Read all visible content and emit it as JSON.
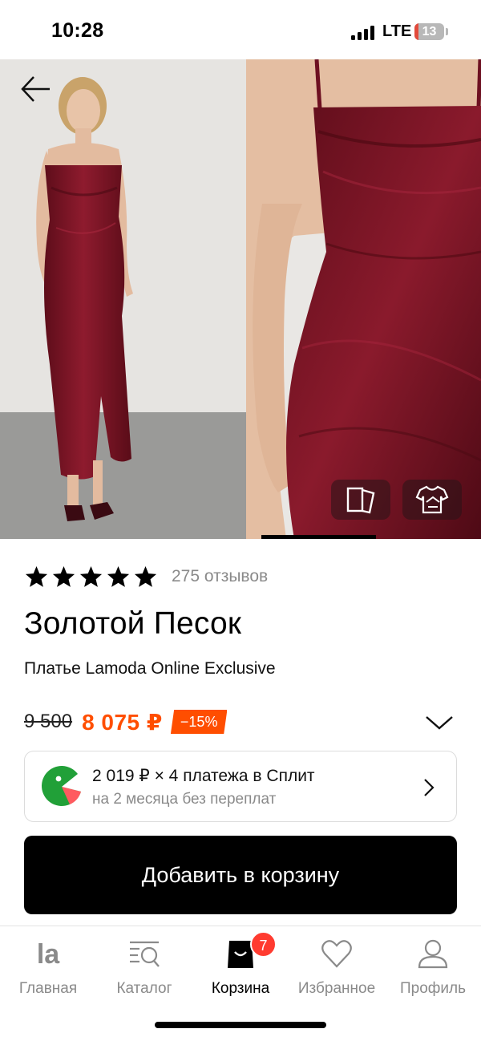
{
  "status_bar": {
    "time": "10:28",
    "network": "LTE",
    "battery": "13",
    "battery_color": "#e24a3b"
  },
  "gallery": {
    "images": [
      {
        "subject": "model wearing burgundy satin maxi dress, full length"
      },
      {
        "subject": "close-up of burgundy satin dress bodice"
      }
    ],
    "dress_color": "#7b1424",
    "back_icon": "arrow-left-icon",
    "buttons": [
      {
        "icon": "compare-icon"
      },
      {
        "icon": "tshirt-tryon-icon"
      }
    ]
  },
  "product": {
    "rating_stars": 5,
    "reviews": "275 отзывов",
    "brand": "Золотой Песок",
    "name": "Платье Lamoda Online Exclusive",
    "old_price": "9 500",
    "price": "8 075 ₽",
    "discount": "−15%",
    "accent_color": "#ff4e00"
  },
  "split": {
    "line1": "2 019 ₽ × 4 платежа в Сплит",
    "line2": "на 2 месяца без переплат",
    "logo_color": "#21a038"
  },
  "cta": {
    "add_to_cart": "Добавить в корзину"
  },
  "bottom_nav": {
    "items": [
      {
        "label": "Главная",
        "icon": "lamoda-logo-icon"
      },
      {
        "label": "Каталог",
        "icon": "catalog-search-icon"
      },
      {
        "label": "Корзина",
        "icon": "shopping-bag-icon",
        "badge": "7",
        "active": true
      },
      {
        "label": "Избранное",
        "icon": "heart-icon"
      },
      {
        "label": "Профиль",
        "icon": "profile-icon"
      }
    ]
  }
}
